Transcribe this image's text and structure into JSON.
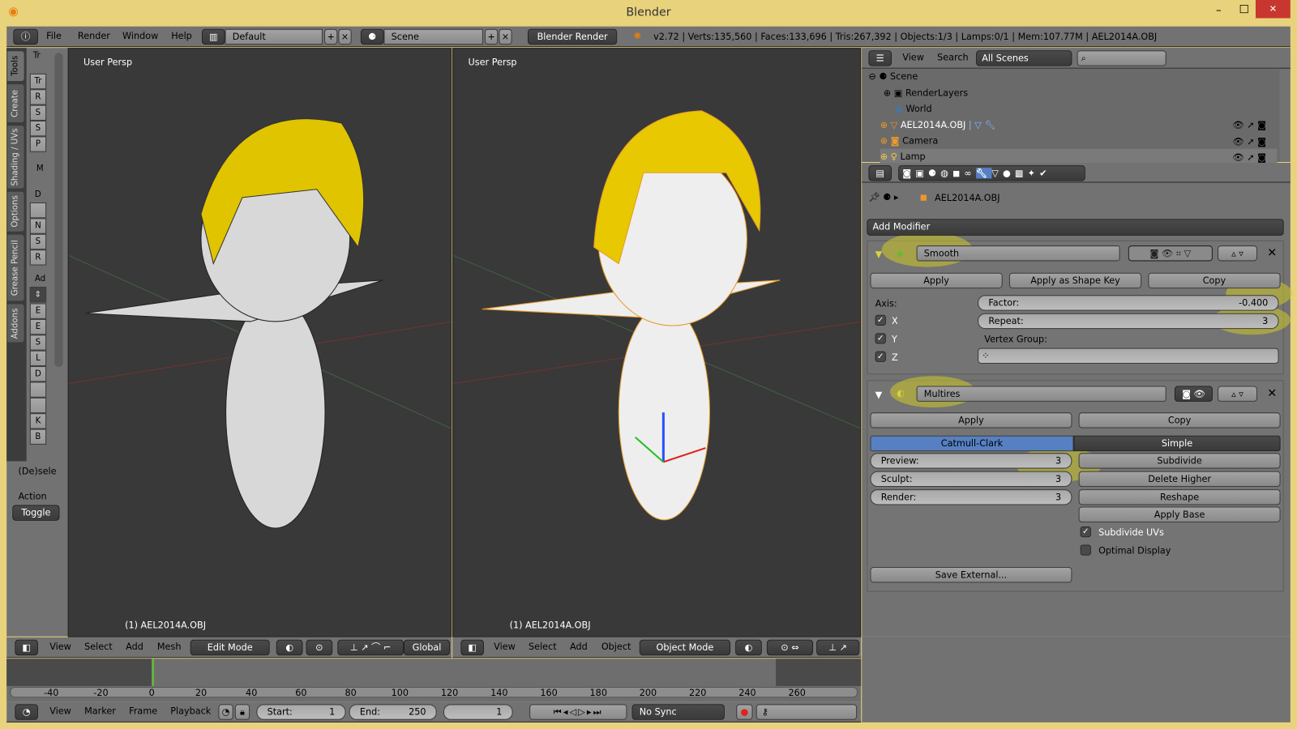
{
  "window": {
    "title": "Blender",
    "minimize": "–",
    "maximize": "□",
    "close": "✕"
  },
  "info_header": {
    "menus": [
      "File",
      "Render",
      "Window",
      "Help"
    ],
    "layout": "Default",
    "scene": "Scene",
    "engine": "Blender Render",
    "stats": "v2.72 | Verts:135,560 | Faces:133,696 | Tris:267,392 | Objects:1/3 | Lamps:0/1 | Mem:107.77M | AEL2014A.OBJ"
  },
  "toolshelf": {
    "tabs": [
      "Tools",
      "Create",
      "Shading / UVs",
      "Options",
      "Grease Pencil",
      "Addons"
    ],
    "transform_header": "Tr",
    "transform_buttons": [
      "Tr",
      "R",
      "S",
      "S",
      "P"
    ],
    "mesh_header": "M",
    "mesh_label": "D",
    "mesh_buttons": [
      "",
      "N",
      "S",
      "R"
    ],
    "add_label": "Ad",
    "add_buttons": [
      "E",
      "E",
      "S",
      "L",
      "D",
      "",
      "",
      "K",
      "B"
    ],
    "operator_title": "(De)sele",
    "action_label": "Action",
    "action_value": "Toggle"
  },
  "viewport_left": {
    "label": "User Persp",
    "object": "(1) AEL2014A.OBJ",
    "menus": [
      "View",
      "Select",
      "Add",
      "Mesh"
    ],
    "mode": "Edit Mode",
    "orientation": "Global"
  },
  "viewport_right": {
    "label": "User Persp",
    "object": "(1) AEL2014A.OBJ",
    "menus": [
      "View",
      "Select",
      "Add",
      "Object"
    ],
    "mode": "Object Mode"
  },
  "timeline": {
    "ticks": [
      "-40",
      "-20",
      "0",
      "20",
      "40",
      "60",
      "80",
      "100",
      "120",
      "140",
      "160",
      "180",
      "200",
      "220",
      "240",
      "260"
    ],
    "current_frame": "1",
    "menus": [
      "View",
      "Marker",
      "Frame",
      "Playback"
    ],
    "start_label": "Start:",
    "start": "1",
    "end_label": "End:",
    "end": "250",
    "sync": "No Sync"
  },
  "outliner": {
    "menus": [
      "View",
      "Search"
    ],
    "filter": "All Scenes",
    "search_placeholder": "",
    "items": [
      {
        "name": "Scene",
        "indent": 0
      },
      {
        "name": "RenderLayers",
        "indent": 1
      },
      {
        "name": "World",
        "indent": 1
      },
      {
        "name": "AEL2014A.OBJ",
        "indent": 1
      },
      {
        "name": "Camera",
        "indent": 1
      },
      {
        "name": "Lamp",
        "indent": 1
      }
    ]
  },
  "properties": {
    "breadcrumb": "AEL2014A.OBJ",
    "add_modifier": "Add Modifier",
    "smooth": {
      "name": "Smooth",
      "apply": "Apply",
      "apply_shape": "Apply as Shape Key",
      "copy": "Copy",
      "axis_label": "Axis:",
      "axes": [
        "X",
        "Y",
        "Z"
      ],
      "factor_label": "Factor:",
      "factor": "-0.400",
      "repeat_label": "Repeat:",
      "repeat": "3",
      "vgroup_label": "Vertex Group:"
    },
    "multires": {
      "name": "Multires",
      "apply": "Apply",
      "copy": "Copy",
      "catmull": "Catmull-Clark",
      "simple": "Simple",
      "preview_label": "Preview:",
      "preview": "3",
      "sculpt_label": "Sculpt:",
      "sculpt": "3",
      "render_label": "Render:",
      "render": "3",
      "subdivide": "Subdivide",
      "delete_higher": "Delete Higher",
      "reshape": "Reshape",
      "apply_base": "Apply Base",
      "subdivide_uvs": "Subdivide UVs",
      "subdivide_uvs_checked": true,
      "optimal_display": "Optimal Display",
      "optimal_display_checked": false,
      "save_external": "Save External..."
    }
  },
  "colors": {
    "accent": "#5680c2",
    "highlight": "#cdc828",
    "hair": "#e8c800",
    "title_bar": "#e8d27c"
  }
}
